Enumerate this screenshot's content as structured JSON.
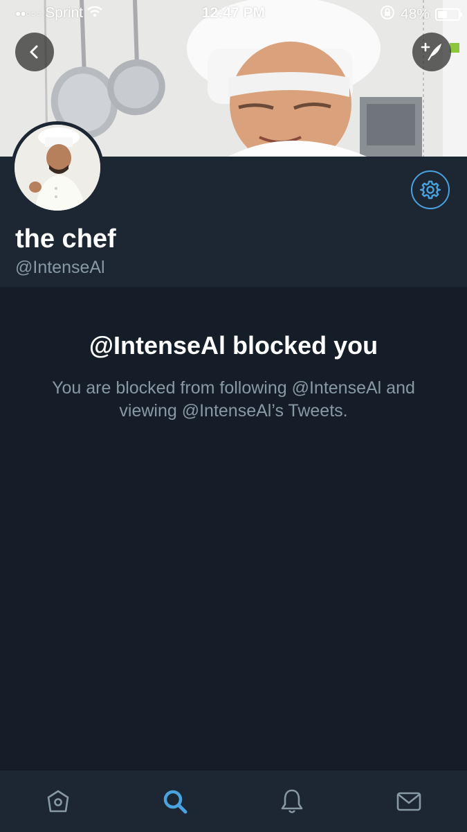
{
  "status_bar": {
    "carrier": "Sprint",
    "time": "12:47 PM",
    "battery": "48%",
    "battery_level": 0.48
  },
  "header": {
    "back_icon": "chevron-left-icon",
    "compose_icon": "compose-tweet-icon"
  },
  "profile": {
    "name": "the chef",
    "handle": "@IntenseAl",
    "settings_icon": "gear-icon"
  },
  "blocked": {
    "title": "@IntenseAl blocked you",
    "message": "You are blocked from following @IntenseAl and viewing @IntenseAl’s Tweets."
  },
  "tabs": [
    {
      "icon": "home-icon",
      "active": false
    },
    {
      "icon": "search-icon",
      "active": true
    },
    {
      "icon": "bell-icon",
      "active": false
    },
    {
      "icon": "mail-icon",
      "active": false
    }
  ],
  "colors": {
    "accent": "#4aa3df",
    "background": "#151d28",
    "panel": "#1c2733",
    "secondary_text": "#8899a6"
  }
}
